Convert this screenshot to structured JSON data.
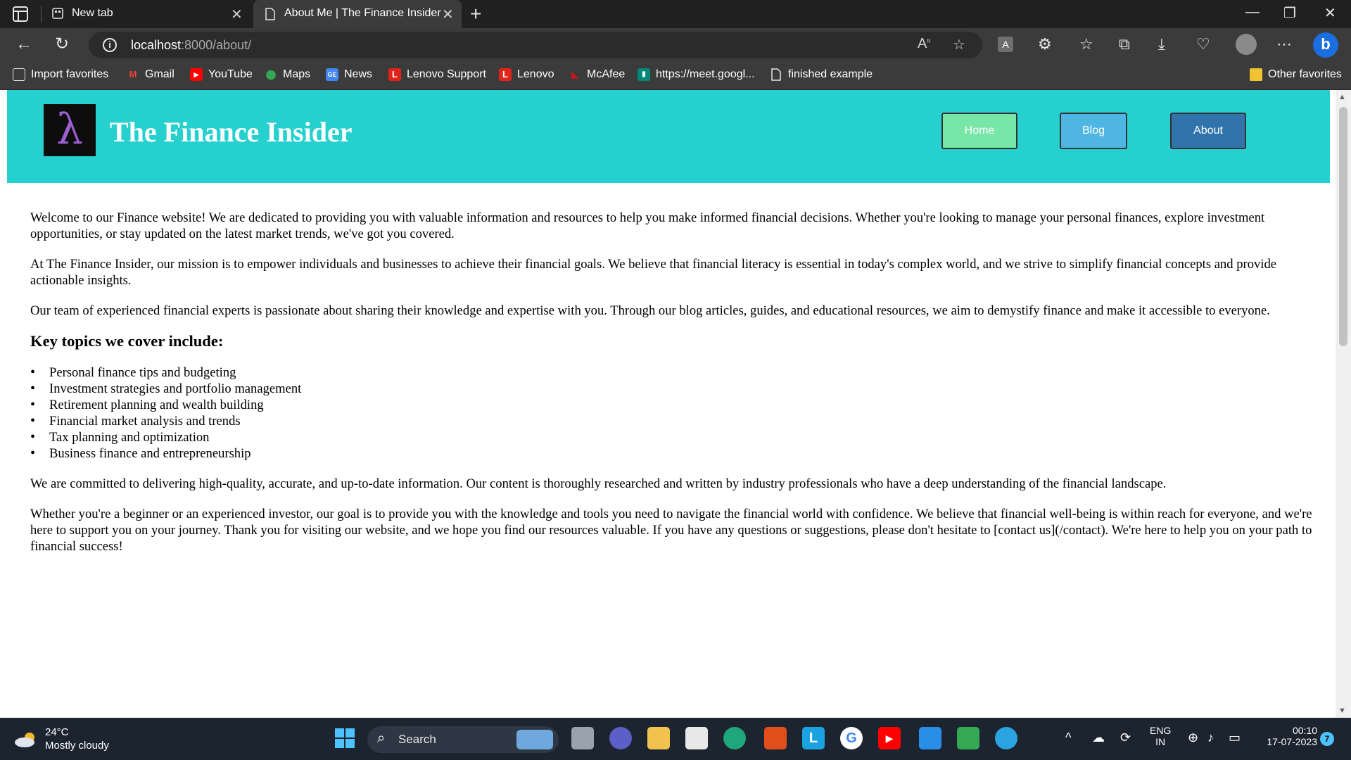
{
  "browser": {
    "tabs": [
      {
        "title": "New tab",
        "active": false
      },
      {
        "title": "About Me | The Finance Insider",
        "active": true
      }
    ],
    "address": {
      "host": "localhost",
      "path": ":8000/about/"
    },
    "favorites": [
      {
        "label": "Import favorites",
        "icon": "import-icon"
      },
      {
        "label": "Gmail",
        "icon": "gmail-icon",
        "color": "#ea4335"
      },
      {
        "label": "YouTube",
        "icon": "youtube-icon",
        "color": "#ff0000"
      },
      {
        "label": "Maps",
        "icon": "maps-icon",
        "color": "#34a853"
      },
      {
        "label": "News",
        "icon": "news-icon",
        "color": "#4285f4"
      },
      {
        "label": "Lenovo Support",
        "icon": "lenovo-icon",
        "color": "#e2231a"
      },
      {
        "label": "Lenovo",
        "icon": "lenovo-icon",
        "color": "#e2231a"
      },
      {
        "label": "McAfee",
        "icon": "mcafee-icon",
        "color": "#c01818"
      },
      {
        "label": "https://meet.googl...",
        "icon": "meet-icon",
        "color": "#00897b"
      },
      {
        "label": "finished example",
        "icon": "page-icon"
      }
    ],
    "other_favorites": "Other favorites"
  },
  "site": {
    "logo_glyph": "λ",
    "title": "The Finance Insider",
    "nav": {
      "home": "Home",
      "blog": "Blog",
      "about": "About"
    },
    "colors": {
      "header": "#26d0ce",
      "home": "#77e6a6",
      "blog": "#4fb6e4",
      "about": "#3174ac"
    }
  },
  "content": {
    "p1": "Welcome to our Finance website! We are dedicated to providing you with valuable information and resources to help you make informed financial decisions. Whether you're looking to manage your personal finances, explore investment opportunities, or stay updated on the latest market trends, we've got you covered.",
    "p2": "At The Finance Insider, our mission is to empower individuals and businesses to achieve their financial goals. We believe that financial literacy is essential in today's complex world, and we strive to simplify financial concepts and provide actionable insights.",
    "p3": "Our team of experienced financial experts is passionate about sharing their knowledge and expertise with you. Through our blog articles, guides, and educational resources, we aim to demystify finance and make it accessible to everyone.",
    "topics_heading": "Key topics we cover include:",
    "topics": [
      "Personal finance tips and budgeting",
      "Investment strategies and portfolio management",
      "Retirement planning and wealth building",
      "Financial market analysis and trends",
      "Tax planning and optimization",
      "Business finance and entrepreneurship"
    ],
    "p4": "We are committed to delivering high-quality, accurate, and up-to-date information. Our content is thoroughly researched and written by industry professionals who have a deep understanding of the financial landscape.",
    "p5": "Whether you're a beginner or an experienced investor, our goal is to provide you with the knowledge and tools you need to navigate the financial world with confidence. We believe that financial well-being is within reach for everyone, and we're here to support you on your journey. Thank you for visiting our website, and we hope you find our resources valuable. If you have any questions or suggestions, please don't hesitate to [contact us](/contact). We're here to help you on your path to financial success!"
  },
  "taskbar": {
    "weather": {
      "temp": "24°C",
      "condition": "Mostly cloudy"
    },
    "search_label": "Search",
    "language": {
      "line1": "ENG",
      "line2": "IN"
    },
    "clock": {
      "time": "00:10",
      "date": "17-07-2023"
    },
    "notification_count": "7"
  }
}
